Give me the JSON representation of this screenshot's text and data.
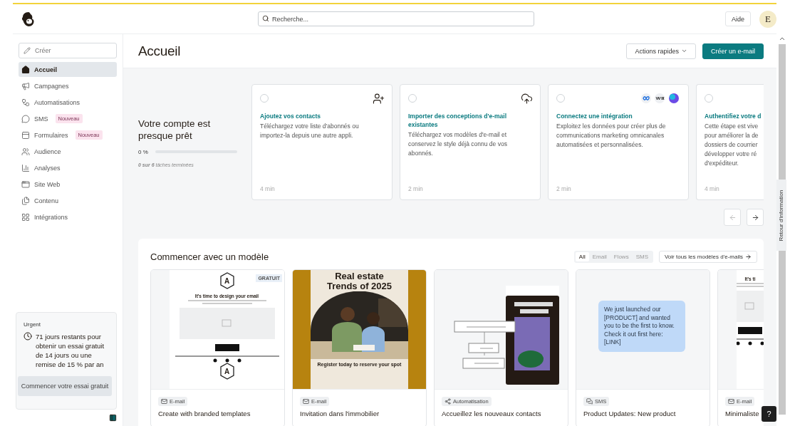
{
  "header": {
    "search": {
      "placeholder": "Recherche..."
    },
    "help": "Aide",
    "avatar": "E"
  },
  "sidebar": {
    "create": "Créer",
    "items": [
      {
        "label": "Accueil",
        "selected": true
      },
      {
        "label": "Campagnes",
        "selected": false
      },
      {
        "label": "Automatisations",
        "selected": false
      },
      {
        "label": "SMS",
        "selected": false,
        "badge": "Nouveau"
      },
      {
        "label": "Formulaires",
        "selected": false,
        "badge": "Nouveau"
      },
      {
        "label": "Audience",
        "selected": false
      },
      {
        "label": "Analyses",
        "selected": false
      },
      {
        "label": "Site Web",
        "selected": false
      },
      {
        "label": "Contenu",
        "selected": false
      },
      {
        "label": "Intégrations",
        "selected": false
      }
    ],
    "urgent": {
      "label": "Urgent",
      "message": "71 jours restants pour obtenir un essai gratuit de 14 jours ou une remise de 15 % par an",
      "button": "Commencer votre essai gratuit"
    }
  },
  "page": {
    "title": "Accueil",
    "actions": [
      {
        "label": "Actions rapides",
        "kind": "menu"
      },
      {
        "label": "Créer un e-mail",
        "kind": "primary"
      }
    ]
  },
  "onboarding": {
    "title": "Votre compte est presque prêt",
    "percent": "0 %",
    "level": 0,
    "summary": "**0 sur 6** tâches terminées",
    "tasks": [
      {
        "done": false,
        "title": "Ajoutez vos contacts",
        "description": "Téléchargez votre liste d'abonnés ou importez-la depuis une autre appli.",
        "duration": "4 min"
      },
      {
        "done": false,
        "title": "Importer des conceptions d'e-mail existantes",
        "description": "Téléchargez vos modèles d'e-mail et conservez le style déjà connu de vos abonnés.",
        "duration": "2 min"
      },
      {
        "done": false,
        "title": "Connectez une intégration",
        "description": "Exploitez les données pour créer plus de communications marketing omnicanales automatisées et personnalisées.",
        "duration": "2 min"
      },
      {
        "done": false,
        "title": "Authentifiez votre d",
        "description": "Cette étape est vive\npour améliorer la de\ndossiers de courrier\ndévelopper votre ré\nd'expéditeur.",
        "duration": "4 min"
      }
    ]
  },
  "templates": {
    "title": "Commencer avec un modèle",
    "filters": [
      {
        "label": "All",
        "selected": true
      },
      {
        "label": "Email",
        "selected": false
      },
      {
        "label": "Flows",
        "selected": false
      },
      {
        "label": "SMS",
        "selected": false
      }
    ],
    "see_all": "Voir tous les modèles d'e-mails",
    "items": [
      {
        "preview": {
          "kind": "design",
          "badge": "GRATUIT",
          "logo_top": "A",
          "heading": "It's time to design your email",
          "logo_bottom": "A"
        },
        "tag": {
          "kind": "email",
          "label": "E-mail"
        },
        "title": "Create with branded templates"
      },
      {
        "preview": {
          "heading": "Real estate\nTrends of 2025",
          "footer": "Register today to reserve your spot"
        },
        "tag": {
          "kind": "email",
          "label": "E-mail"
        },
        "title": "Invitation dans l'immobilier"
      },
      {
        "preview": {
          "kind": "flow"
        },
        "tag": {
          "kind": "automation",
          "label": "Automatisation"
        },
        "title": "Accueillez les nouveaux contacts"
      },
      {
        "preview": {
          "kind": "sms",
          "message": "We just launched our [PRODUCT] and wanted you to be the first to know. Check it out first here: [LINK]"
        },
        "tag": {
          "kind": "sms",
          "label": "SMS"
        },
        "title": "Product Updates: New product"
      },
      {
        "preview": {
          "kind": "design",
          "heading": "It's ti"
        },
        "tag": {
          "kind": "email",
          "label": "E-mail"
        },
        "title": "Minimaliste"
      }
    ]
  },
  "feedback": "Retour d'information",
  "help_button": "?"
}
